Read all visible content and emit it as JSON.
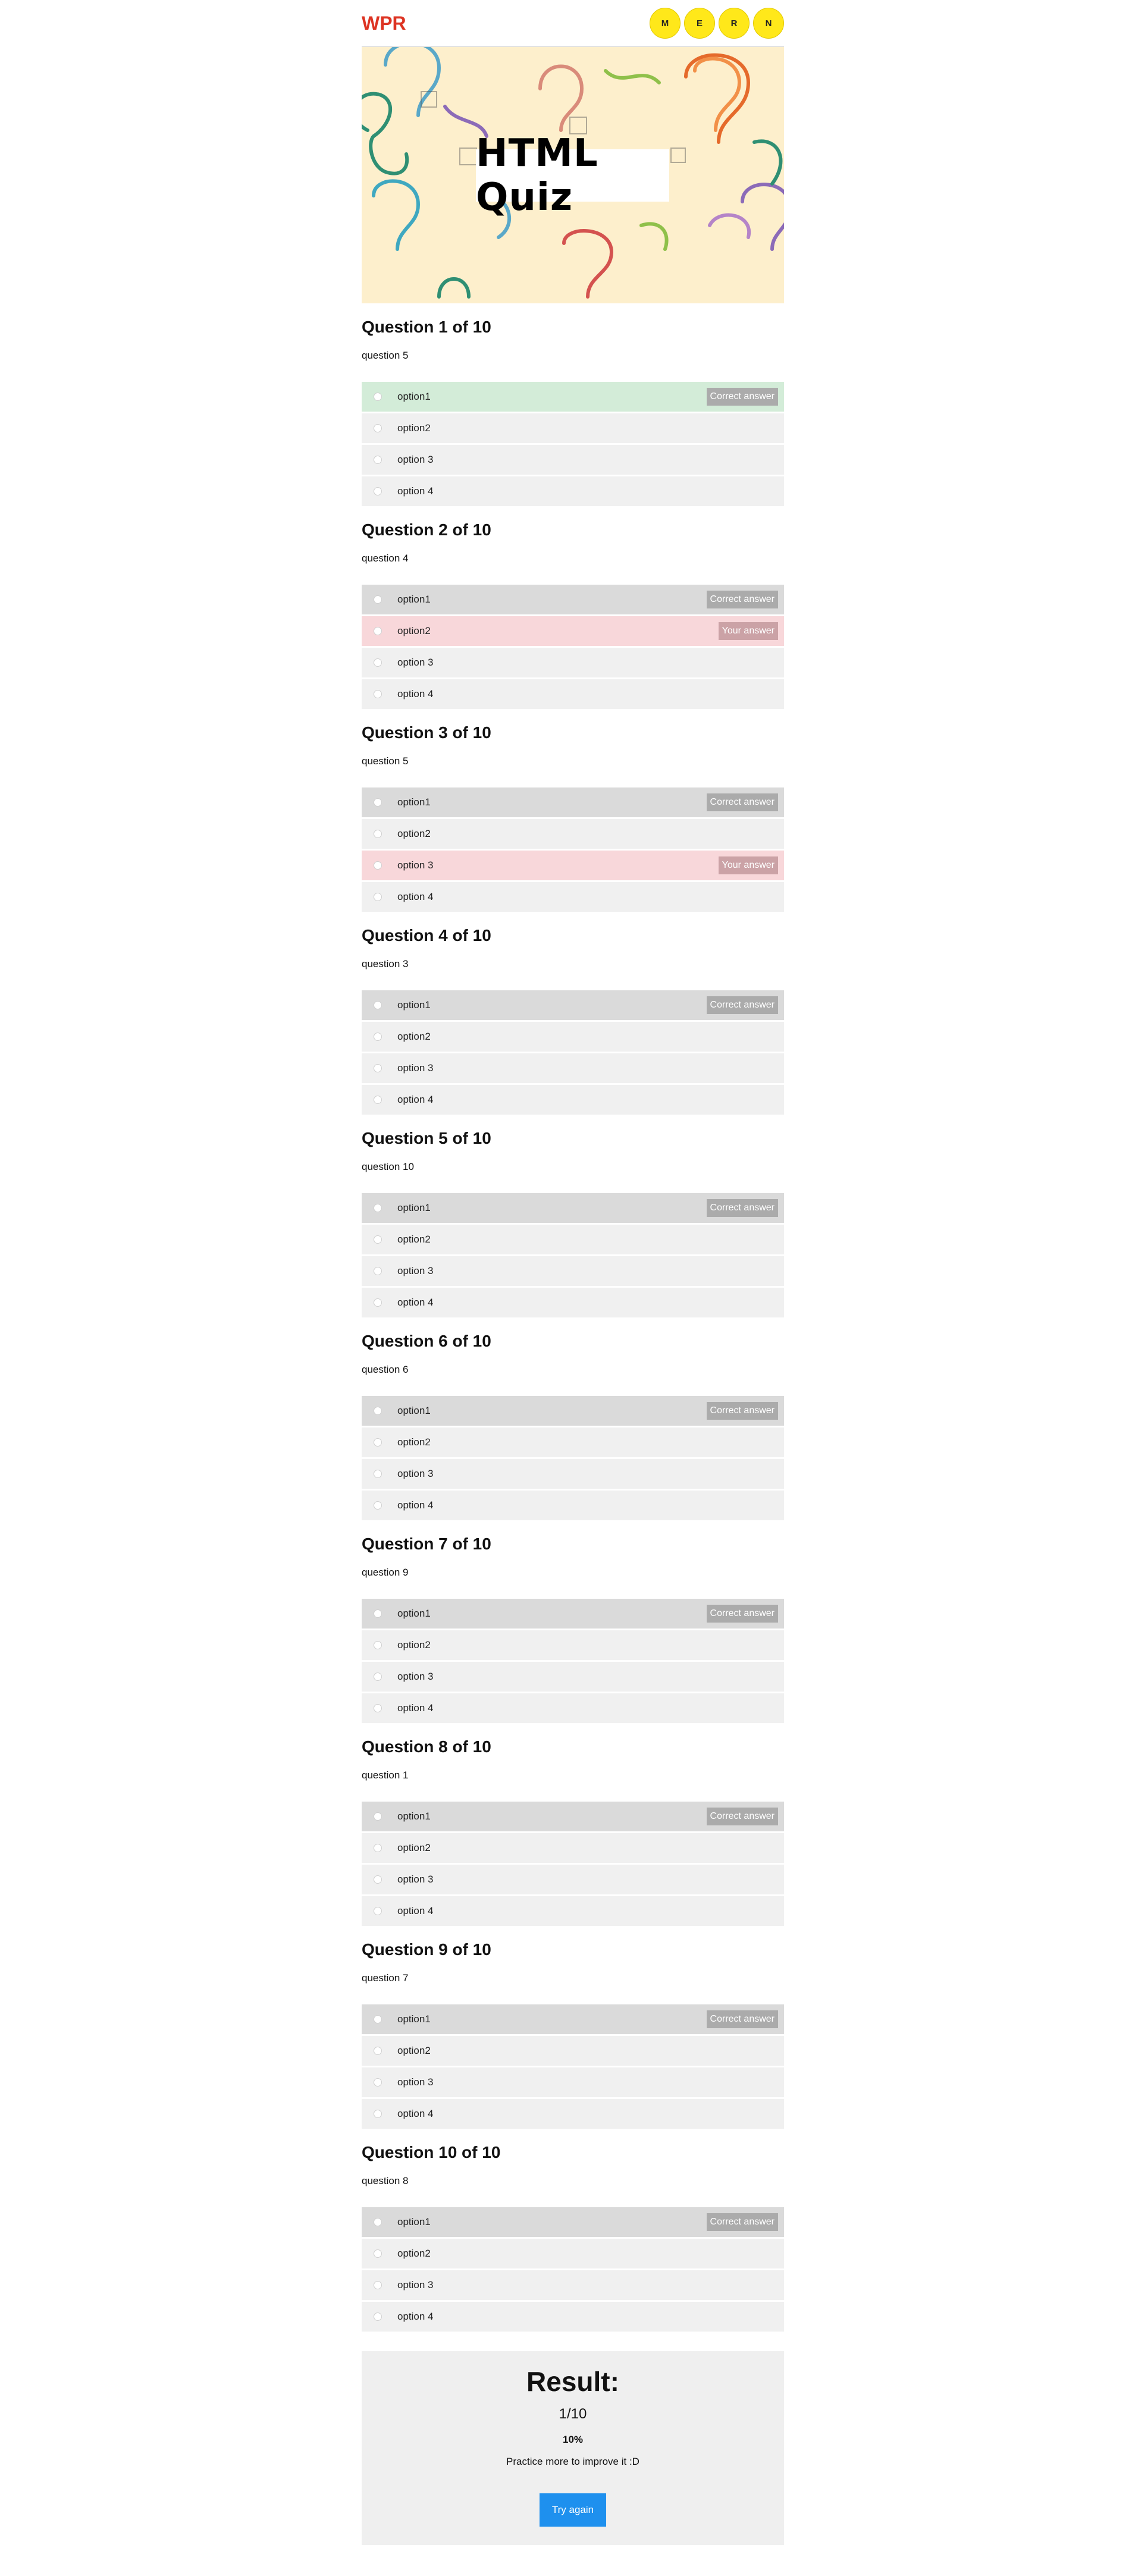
{
  "header": {
    "brand": "WPR",
    "badges": [
      "M",
      "E",
      "R",
      "N"
    ],
    "badge_color": "#ffe81a",
    "brand_color": "#dd3322"
  },
  "banner": {
    "title": "HTML Quiz",
    "background_color": "#fdefcc"
  },
  "questions": [
    {
      "heading": "Question 1 of 10",
      "prompt": "question 5",
      "options": [
        {
          "label": "option1",
          "state": "right",
          "tag": "Correct answer"
        },
        {
          "label": "option2",
          "state": "",
          "tag": ""
        },
        {
          "label": "option 3",
          "state": "",
          "tag": ""
        },
        {
          "label": "option 4",
          "state": "",
          "tag": ""
        }
      ]
    },
    {
      "heading": "Question 2 of 10",
      "prompt": "question 4",
      "options": [
        {
          "label": "option1",
          "state": "chosen",
          "tag": "Correct answer"
        },
        {
          "label": "option2",
          "state": "wrong",
          "tag": "Your answer"
        },
        {
          "label": "option 3",
          "state": "",
          "tag": ""
        },
        {
          "label": "option 4",
          "state": "",
          "tag": ""
        }
      ]
    },
    {
      "heading": "Question 3 of 10",
      "prompt": "question 5",
      "options": [
        {
          "label": "option1",
          "state": "chosen",
          "tag": "Correct answer"
        },
        {
          "label": "option2",
          "state": "",
          "tag": ""
        },
        {
          "label": "option 3",
          "state": "wrong",
          "tag": "Your answer"
        },
        {
          "label": "option 4",
          "state": "",
          "tag": ""
        }
      ]
    },
    {
      "heading": "Question 4 of 10",
      "prompt": "question 3",
      "options": [
        {
          "label": "option1",
          "state": "chosen",
          "tag": "Correct answer"
        },
        {
          "label": "option2",
          "state": "",
          "tag": ""
        },
        {
          "label": "option 3",
          "state": "",
          "tag": ""
        },
        {
          "label": "option 4",
          "state": "",
          "tag": ""
        }
      ]
    },
    {
      "heading": "Question 5 of 10",
      "prompt": "question 10",
      "options": [
        {
          "label": "option1",
          "state": "chosen",
          "tag": "Correct answer"
        },
        {
          "label": "option2",
          "state": "",
          "tag": ""
        },
        {
          "label": "option 3",
          "state": "",
          "tag": ""
        },
        {
          "label": "option 4",
          "state": "",
          "tag": ""
        }
      ]
    },
    {
      "heading": "Question 6 of 10",
      "prompt": "question 6",
      "options": [
        {
          "label": "option1",
          "state": "chosen",
          "tag": "Correct answer"
        },
        {
          "label": "option2",
          "state": "",
          "tag": ""
        },
        {
          "label": "option 3",
          "state": "",
          "tag": ""
        },
        {
          "label": "option 4",
          "state": "",
          "tag": ""
        }
      ]
    },
    {
      "heading": "Question 7 of 10",
      "prompt": "question 9",
      "options": [
        {
          "label": "option1",
          "state": "chosen",
          "tag": "Correct answer"
        },
        {
          "label": "option2",
          "state": "",
          "tag": ""
        },
        {
          "label": "option 3",
          "state": "",
          "tag": ""
        },
        {
          "label": "option 4",
          "state": "",
          "tag": ""
        }
      ]
    },
    {
      "heading": "Question 8 of 10",
      "prompt": "question 1",
      "options": [
        {
          "label": "option1",
          "state": "chosen",
          "tag": "Correct answer"
        },
        {
          "label": "option2",
          "state": "",
          "tag": ""
        },
        {
          "label": "option 3",
          "state": "",
          "tag": ""
        },
        {
          "label": "option 4",
          "state": "",
          "tag": ""
        }
      ]
    },
    {
      "heading": "Question 9 of 10",
      "prompt": "question 7",
      "options": [
        {
          "label": "option1",
          "state": "chosen",
          "tag": "Correct answer"
        },
        {
          "label": "option2",
          "state": "",
          "tag": ""
        },
        {
          "label": "option 3",
          "state": "",
          "tag": ""
        },
        {
          "label": "option 4",
          "state": "",
          "tag": ""
        }
      ]
    },
    {
      "heading": "Question 10 of 10",
      "prompt": "question 8",
      "options": [
        {
          "label": "option1",
          "state": "chosen",
          "tag": "Correct answer"
        },
        {
          "label": "option2",
          "state": "",
          "tag": ""
        },
        {
          "label": "option 3",
          "state": "",
          "tag": ""
        },
        {
          "label": "option 4",
          "state": "",
          "tag": ""
        }
      ]
    }
  ],
  "result": {
    "title": "Result:",
    "score": "1/10",
    "percent": "10%",
    "message": "Practice more to improve it :D",
    "button_label": "Try again",
    "button_color": "#1e90ee"
  },
  "colors": {
    "option_background": "#f0f0f0",
    "chosen_background": "#dadada",
    "correct_background": "#d3ecd8",
    "wrong_background": "#f8d7da"
  }
}
